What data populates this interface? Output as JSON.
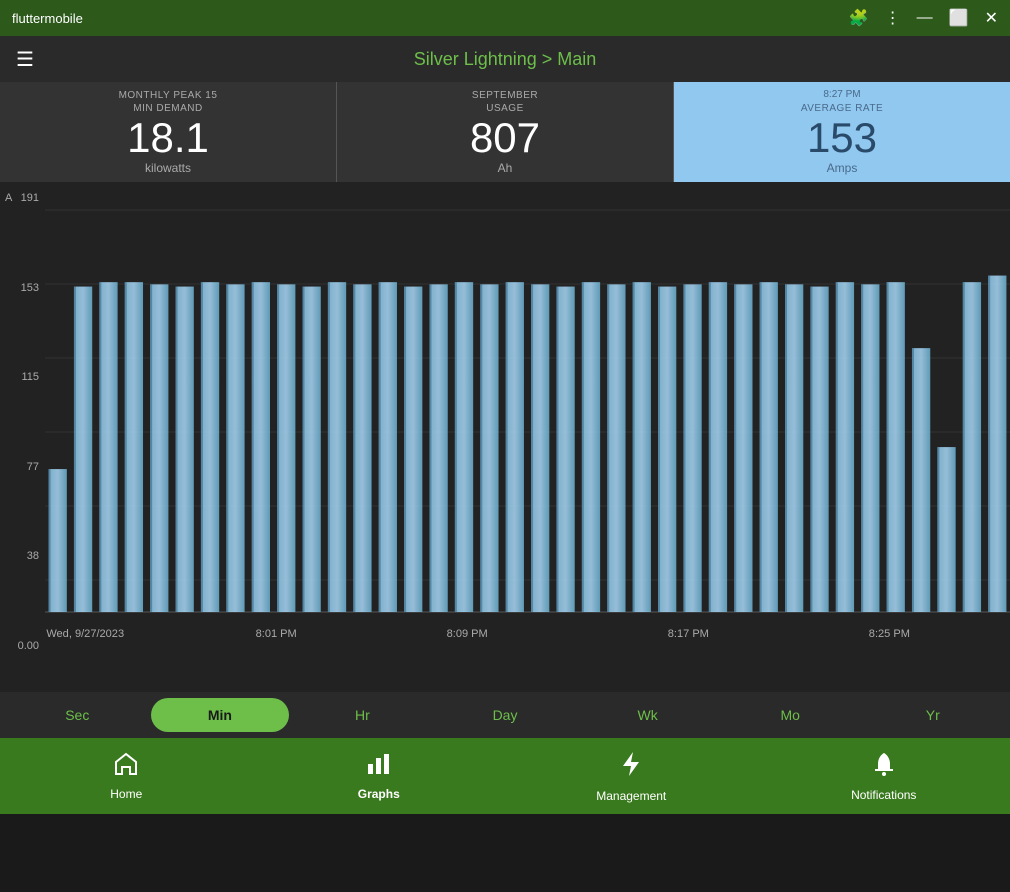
{
  "titleBar": {
    "appName": "fluttermobile",
    "icons": [
      "puzzle-icon",
      "menu-dots-icon",
      "minimize-icon",
      "restore-icon",
      "close-icon"
    ]
  },
  "header": {
    "menuLabel": "☰",
    "title": "Silver Lightning > Main"
  },
  "stats": [
    {
      "id": "monthly-peak",
      "label": "MONTHLY PEAK 15\nMIN DEMAND",
      "value": "18.1",
      "unit": "kilowatts",
      "highlighted": false
    },
    {
      "id": "september-usage",
      "label": "SEPTEMBER\nUSAGE",
      "value": "807",
      "unit": "Ah",
      "highlighted": false
    },
    {
      "id": "average-rate",
      "label": "AVERAGE RATE",
      "time": "8:27 PM",
      "value": "153",
      "unit": "Amps",
      "highlighted": true
    }
  ],
  "chart": {
    "yAxisLabel": "A",
    "yAxisValues": [
      "191",
      "153",
      "115",
      "77",
      "38",
      "0.00"
    ],
    "xAxisValues": [
      "Wed, 9/27/2023",
      "8:01 PM",
      "8:09 PM",
      "8:17 PM",
      "8:25 PM"
    ],
    "barData": [
      65,
      148,
      150,
      150,
      149,
      148,
      150,
      149,
      150,
      149,
      148,
      150,
      149,
      150,
      148,
      149,
      150,
      149,
      150,
      149,
      148,
      150,
      149,
      150,
      148,
      149,
      150,
      149,
      150,
      149,
      148,
      150,
      149,
      150,
      120,
      75,
      150,
      153
    ]
  },
  "timeTabs": [
    {
      "id": "sec",
      "label": "Sec",
      "active": false
    },
    {
      "id": "min",
      "label": "Min",
      "active": true
    },
    {
      "id": "hr",
      "label": "Hr",
      "active": false
    },
    {
      "id": "day",
      "label": "Day",
      "active": false
    },
    {
      "id": "wk",
      "label": "Wk",
      "active": false
    },
    {
      "id": "mo",
      "label": "Mo",
      "active": false
    },
    {
      "id": "yr",
      "label": "Yr",
      "active": false
    }
  ],
  "bottomNav": [
    {
      "id": "home",
      "icon": "🏠",
      "label": "Home",
      "active": false
    },
    {
      "id": "graphs",
      "icon": "📊",
      "label": "Graphs",
      "active": true
    },
    {
      "id": "management",
      "icon": "⚡",
      "label": "Management",
      "active": false
    },
    {
      "id": "notifications",
      "icon": "🔔",
      "label": "Notifications",
      "active": false
    }
  ],
  "colors": {
    "accent": "#6dbf4a",
    "headerBg": "#2a2a2a",
    "titleBarBg": "#2d5a1b",
    "statsBg": "#333333",
    "chartBg": "#222222",
    "highlightedStatBg": "#90c8f0",
    "bottomNavBg": "#3a7a1e",
    "barColor": "#7ab8d8",
    "barColorDark": "#4a7a9a"
  }
}
